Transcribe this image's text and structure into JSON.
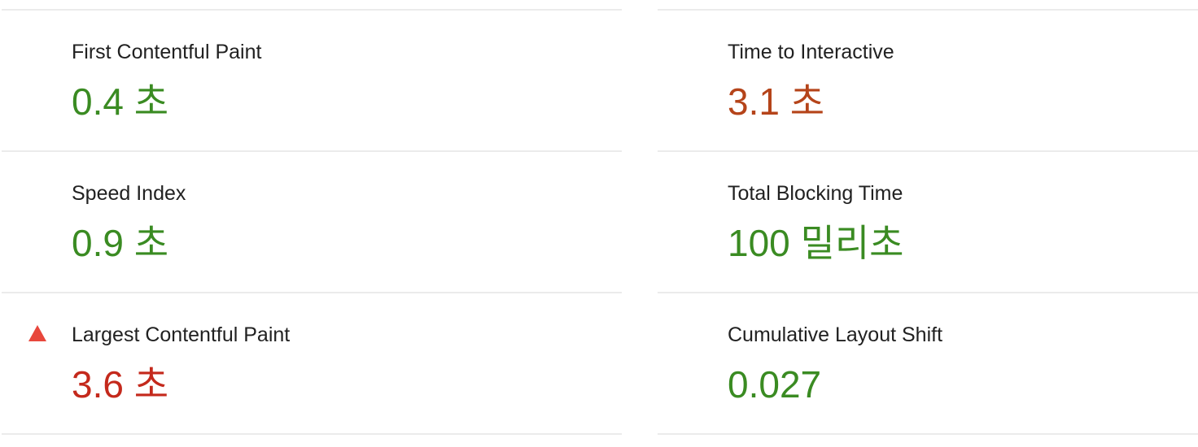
{
  "metrics": {
    "left": [
      {
        "label": "First Contentful Paint",
        "value": "0.4 초",
        "status": "pass"
      },
      {
        "label": "Speed Index",
        "value": "0.9 초",
        "status": "pass"
      },
      {
        "label": "Largest Contentful Paint",
        "value": "3.6 초",
        "status": "fail"
      }
    ],
    "right": [
      {
        "label": "Time to Interactive",
        "value": "3.1 초",
        "status": "average"
      },
      {
        "label": "Total Blocking Time",
        "value": "100 밀리초",
        "status": "pass"
      },
      {
        "label": "Cumulative Layout Shift",
        "value": "0.027",
        "status": "pass"
      }
    ]
  },
  "colors": {
    "pass": "#3a8b22",
    "average": "#b5441a",
    "fail": "#c4291c",
    "fail_icon": "#e8473c",
    "divider": "#ebebeb"
  },
  "icons": {
    "fail": "warning-triangle-icon"
  }
}
